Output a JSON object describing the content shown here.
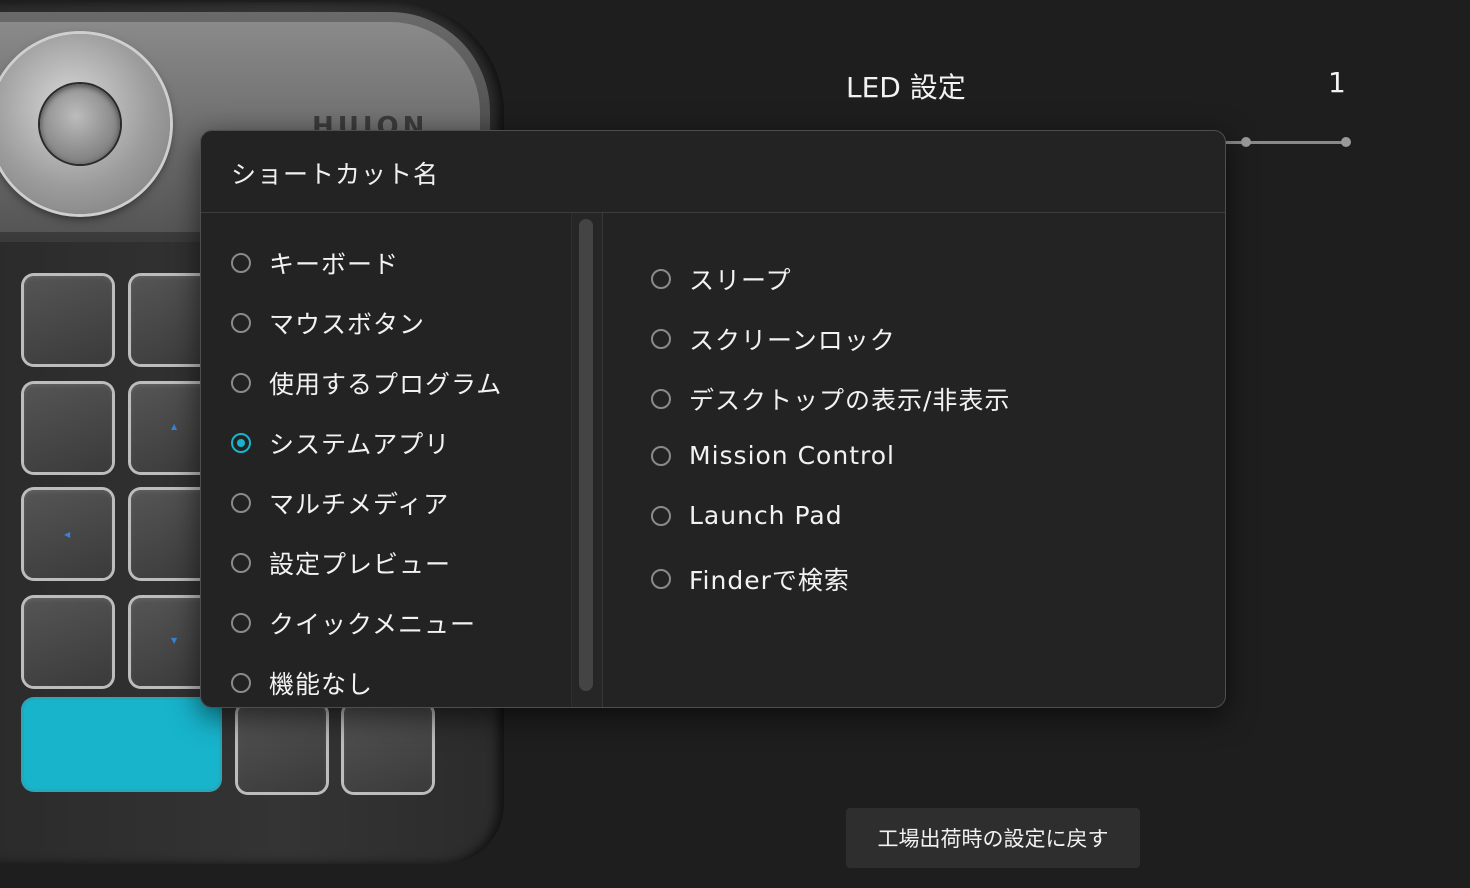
{
  "device": {
    "brand": "HUION"
  },
  "settings": {
    "led_title": "LED 設定",
    "led_value": "1",
    "reset_label": "工場出荷時の設定に戻す"
  },
  "popup": {
    "title": "ショートカット名",
    "categories": [
      {
        "label": "キーボード",
        "selected": false
      },
      {
        "label": "マウスボタン",
        "selected": false
      },
      {
        "label": "使用するプログラム",
        "selected": false
      },
      {
        "label": "システムアプリ",
        "selected": true
      },
      {
        "label": "マルチメディア",
        "selected": false
      },
      {
        "label": "設定プレビュー",
        "selected": false
      },
      {
        "label": "クイックメニュー",
        "selected": false
      },
      {
        "label": "機能なし",
        "selected": false
      }
    ],
    "system_apps": [
      {
        "label": "スリープ",
        "selected": false
      },
      {
        "label": "スクリーンロック",
        "selected": false
      },
      {
        "label": "デスクトップの表示/非表示",
        "selected": false
      },
      {
        "label": "Mission Control",
        "selected": false
      },
      {
        "label": "Launch Pad",
        "selected": false
      },
      {
        "label": "Finderで検索",
        "selected": false
      }
    ]
  },
  "colors": {
    "accent": "#17b4cc",
    "background": "#1e1e1e",
    "popup_bg": "#232323"
  }
}
